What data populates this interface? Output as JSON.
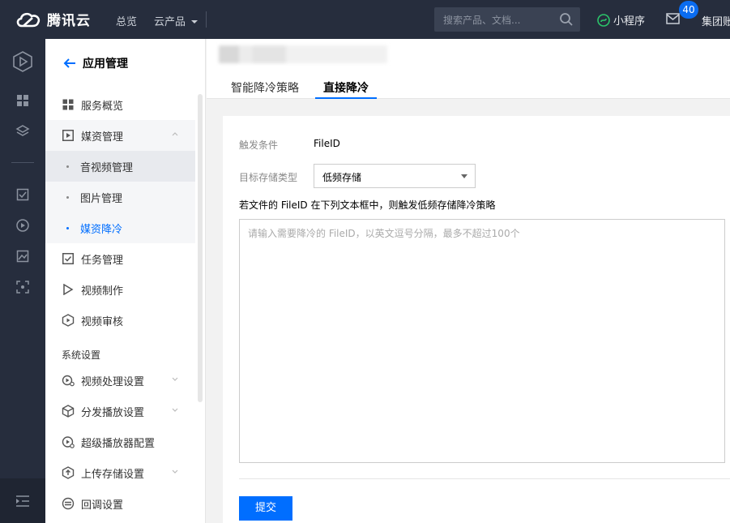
{
  "topbar": {
    "brand": "腾讯云",
    "nav": [
      "总览",
      "云产品"
    ],
    "search_placeholder": "搜索产品、文档...",
    "mini_program": "小程序",
    "mail_count": "40",
    "account": "集团账"
  },
  "sidebar": {
    "back_label": "应用管理",
    "items": [
      {
        "label": "服务概览",
        "icon": "grid-icon"
      },
      {
        "label": "媒资管理",
        "icon": "play-square-icon"
      },
      {
        "label": "音视频管理"
      },
      {
        "label": "图片管理"
      },
      {
        "label": "媒资降冷"
      },
      {
        "label": "任务管理",
        "icon": "check-square-icon"
      },
      {
        "label": "视频制作",
        "icon": "play-outline-icon"
      },
      {
        "label": "视频审核",
        "icon": "hexagon-play-icon"
      },
      {
        "label": "视频处理设置",
        "icon": "gear-play-icon"
      },
      {
        "label": "分发播放设置",
        "icon": "cube-icon"
      },
      {
        "label": "超级播放器配置",
        "icon": "player-config-icon"
      },
      {
        "label": "上传存储设置",
        "icon": "upload-storage-icon"
      },
      {
        "label": "回调设置",
        "icon": "callback-icon"
      }
    ],
    "section_title": "系统设置"
  },
  "tabs": [
    "智能降冷策略",
    "直接降冷"
  ],
  "form": {
    "trigger_label": "触发条件",
    "trigger_value": "FileID",
    "storage_label": "目标存储类型",
    "storage_value": "低频存储",
    "hint": "若文件的 FileID 在下列文本框中，则触发低频存储降冷策略",
    "textarea_placeholder": "请输入需要降冷的 FileID，以英文逗号分隔，最多不超过100个",
    "submit_label": "提交"
  },
  "colors": {
    "accent": "#006eff",
    "topbar": "#262d3d"
  }
}
